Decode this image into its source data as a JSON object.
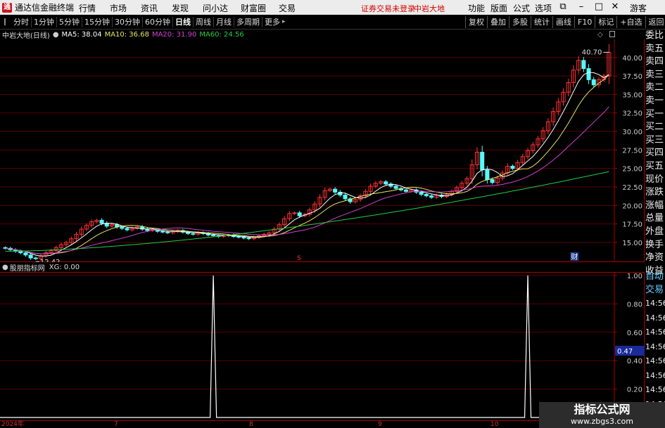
{
  "title_bar": {
    "app_title": "通达信金融终端",
    "menus": [
      "行情",
      "市场",
      "资讯",
      "发现",
      "问小达",
      "财富圈",
      "交易"
    ],
    "warning": "证券交易未登录",
    "stock": "中岩大地",
    "right_menus": [
      "功能",
      "版面",
      "公式",
      "选项"
    ],
    "guest": "游客"
  },
  "period_tabs": [
    "分时",
    "1分钟",
    "5分钟",
    "15分钟",
    "30分钟",
    "60分钟",
    "日线",
    "周线",
    "月线",
    "多周期",
    "更多"
  ],
  "active_period": "日线",
  "toolbar": [
    "复权",
    "叠加",
    "多股",
    "统计",
    "画线",
    "F10",
    "标记",
    "+自选",
    "返回"
  ],
  "main_chart": {
    "title": "中岩大地(日线)",
    "ma": [
      {
        "label": "MA5: 38.04",
        "color": "#ffffff"
      },
      {
        "label": "MA10: 36.68",
        "color": "#e5e566"
      },
      {
        "label": "MA20: 31.90",
        "color": "#d040d0"
      },
      {
        "label": "MA60: 24.56",
        "color": "#22cc44"
      }
    ],
    "high_label": "40.70",
    "low_label": "12.42",
    "marker_s": "S",
    "marker_cai": "财"
  },
  "sub_chart": {
    "title": "股朋指标网",
    "xg_label": "XG: 0.00",
    "current_value": "0.47"
  },
  "chart_data": [
    {
      "type": "candlestick",
      "title": "中岩大地(日线)",
      "y_ticks": [
        "40.00",
        "37.50",
        "35.00",
        "32.50",
        "30.00",
        "27.50",
        "25.00",
        "22.50",
        "20.00",
        "17.50",
        "15.00"
      ],
      "ylim": [
        13.0,
        41.5
      ],
      "x_labels": [
        "7",
        "8",
        "9",
        "10"
      ],
      "ma_values": {
        "MA5": 38.04,
        "MA10": 36.68,
        "MA20": 31.9,
        "MA60": 24.56
      },
      "close": [
        14.2,
        14.0,
        13.8,
        13.6,
        13.3,
        12.9,
        12.8,
        13.2,
        13.6,
        13.9,
        14.3,
        14.7,
        15.0,
        15.5,
        16.1,
        16.8,
        17.3,
        17.8,
        18.0,
        17.6,
        17.2,
        17.4,
        17.1,
        16.9,
        16.7,
        16.9,
        17.1,
        16.8,
        16.6,
        16.7,
        16.5,
        16.4,
        16.3,
        16.5,
        16.6,
        16.4,
        16.2,
        16.1,
        16.3,
        16.2,
        16.0,
        15.9,
        15.8,
        15.9,
        16.0,
        15.8,
        15.7,
        15.6,
        15.5,
        15.7,
        15.9,
        16.1,
        16.3,
        16.8,
        17.4,
        18.2,
        18.9,
        19.0,
        18.6,
        18.8,
        19.4,
        20.2,
        21.1,
        22.0,
        22.2,
        21.8,
        21.4,
        20.9,
        20.5,
        20.8,
        21.3,
        21.9,
        22.6,
        23.0,
        23.2,
        22.9,
        22.6,
        22.3,
        22.1,
        21.9,
        22.1,
        21.8,
        21.5,
        21.3,
        21.1,
        21.4,
        21.2,
        21.5,
        21.9,
        22.4,
        23.0,
        23.6,
        25.5,
        27.2,
        24.8,
        23.5,
        23.1,
        23.7,
        24.4,
        25.3,
        25.0,
        25.8,
        26.6,
        27.4,
        28.2,
        29.0,
        30.1,
        31.3,
        32.7,
        34.0,
        35.3,
        36.6,
        38.3,
        39.6,
        38.5,
        37.0,
        36.3,
        37.0,
        37.5,
        40.7
      ],
      "ma60_start": 13.8,
      "ma60_end": 24.56
    },
    {
      "type": "line",
      "title": "股朋指标网",
      "series": [
        {
          "name": "XG",
          "values": [
            0,
            0,
            1,
            0,
            0,
            1,
            0,
            0
          ]
        }
      ],
      "y_ticks": [
        "1.00",
        "0.80",
        "0.60",
        "0.40",
        "0.20"
      ],
      "ylim": [
        0,
        1
      ],
      "spike_candle_index": [
        41,
        103
      ]
    }
  ],
  "sidebar": {
    "quote_labels": [
      "委比",
      "卖五",
      "卖四",
      "卖三",
      "卖二",
      "卖一",
      "买一",
      "买二",
      "买三",
      "买四",
      "买五",
      "现价",
      "涨跌",
      "涨幅",
      "总量",
      "外盘",
      "换手",
      "净资",
      "收益"
    ],
    "sub_labels": [
      "自动",
      "交易"
    ],
    "times": [
      "14:56",
      "14:56",
      "14:56",
      "14:56",
      "14:56",
      "14:56",
      "14:56",
      "14:56",
      "14:56"
    ]
  },
  "date_axis": {
    "year": "2024年",
    "months": [
      "7",
      "8",
      "9",
      "10"
    ]
  },
  "watermark": {
    "text": "指标公式网",
    "url": "www.zbgs3.com"
  },
  "colors": {
    "up": "#ff3232",
    "down": "#54fcfc",
    "grid": "#5a0000",
    "frame": "#aa0000",
    "ma5": "#ffffff",
    "ma10": "#e5e566",
    "ma20": "#d040d0",
    "ma60": "#22cc44"
  }
}
